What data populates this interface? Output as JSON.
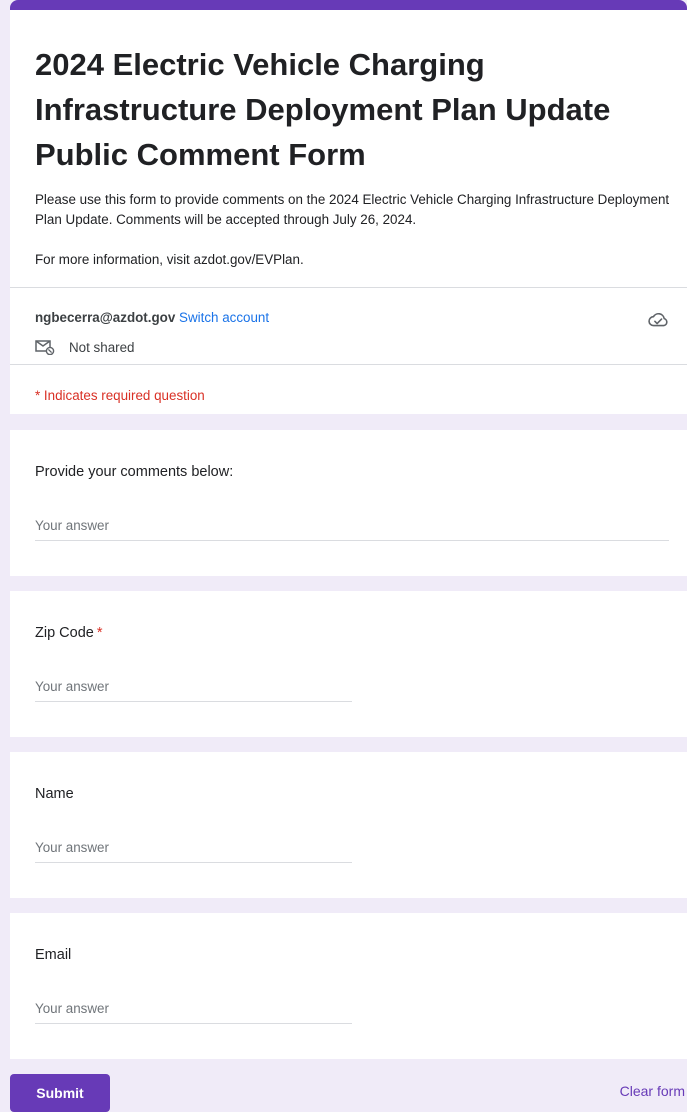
{
  "form": {
    "title": "2024 Electric Vehicle Charging Infrastructure Deployment Plan Update Public Comment Form",
    "description_1": "Please use this form to provide comments on the 2024 Electric Vehicle Charging Infrastructure Deployment Plan Update. Comments will be accepted through July 26, 2024.",
    "description_2": "For more information, visit azdot.gov/EVPlan.",
    "accent_color": "#673ab7"
  },
  "account": {
    "email": "ngbecerra@azdot.gov",
    "switch_label": "Switch account",
    "shared_status": "Not shared",
    "cloud_icon": "cloud-check-icon",
    "shared_icon": "mail-not-shared-icon"
  },
  "required_note": "* Indicates required question",
  "questions": [
    {
      "label": "Provide your comments below:",
      "required": false,
      "placeholder": "Your answer"
    },
    {
      "label": "Zip Code",
      "required": true,
      "required_mark": "*",
      "placeholder": "Your answer"
    },
    {
      "label": "Name",
      "required": false,
      "placeholder": "Your answer"
    },
    {
      "label": "Email",
      "required": false,
      "placeholder": "Your answer"
    }
  ],
  "actions": {
    "submit_label": "Submit",
    "clear_label": "Clear form"
  }
}
